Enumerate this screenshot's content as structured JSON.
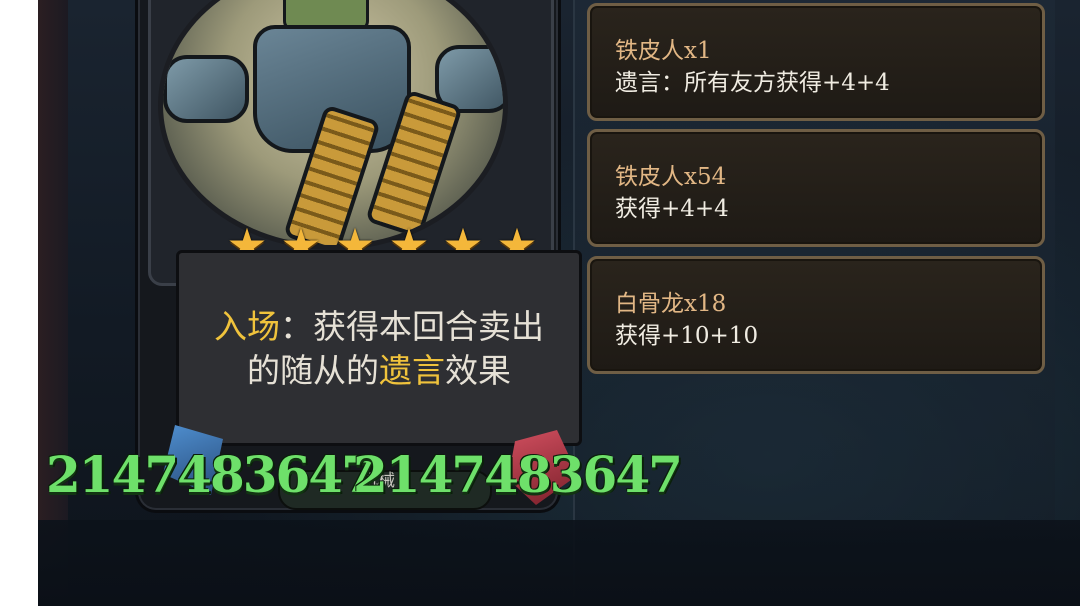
{
  "card": {
    "star_count": 6,
    "star_glyph": "★",
    "description": {
      "keyword1": "入场",
      "part1": "：获得本回合卖出",
      "part2": "的随从的",
      "keyword2": "遗言",
      "part3": "效果"
    },
    "attack": "2147483647",
    "health": "2147483647",
    "tribe": "机械"
  },
  "entries": [
    {
      "name": "铁皮人x1",
      "effect": "遗言：所有友方获得+4+4"
    },
    {
      "name": "铁皮人x54",
      "effect": "获得+4+4"
    },
    {
      "name": "白骨龙x18",
      "effect": "获得+10+10"
    }
  ],
  "colors": {
    "keyword": "#f0c33c",
    "stat": "#6ee06a",
    "entry_name": "#e2b785",
    "entry_border": "#6f5e45",
    "star": "#f4b73a"
  }
}
